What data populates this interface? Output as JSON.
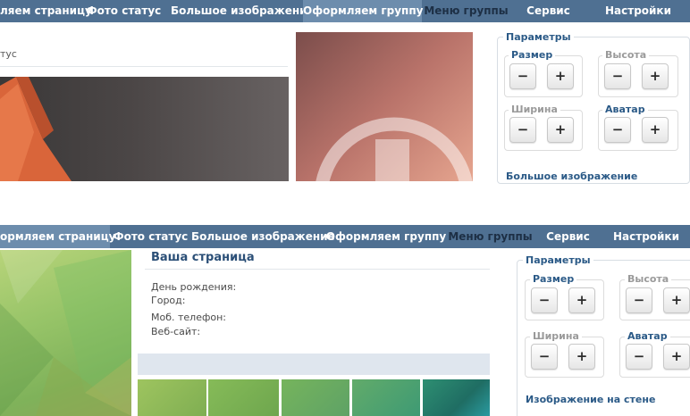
{
  "top": {
    "nav": [
      "ляем страницу",
      "Фото статус",
      "Большое изображение",
      "Оформляем группу",
      "Меню группы",
      "Сервис",
      "Настройки"
    ],
    "status_fragment": "тус",
    "params": {
      "title": "Параметры",
      "groups": [
        {
          "label": "Размер",
          "minus": "−",
          "plus": "+"
        },
        {
          "label": "Высота",
          "minus": "−",
          "plus": "+"
        },
        {
          "label": "Ширина",
          "minus": "−",
          "plus": "+"
        },
        {
          "label": "Аватар",
          "minus": "−",
          "plus": "+"
        }
      ],
      "next_section": "Большое изображение"
    }
  },
  "bottom": {
    "nav": [
      "ормляем страницу",
      "Фото статус",
      "Большое изображение",
      "Оформляем группу",
      "Меню группы",
      "Сервис",
      "Настройки"
    ],
    "page_title": "Ваша страница",
    "info": [
      "День рождения:",
      "Город:",
      "Моб. телефон:",
      "Веб-сайт:"
    ],
    "params": {
      "title": "Параметры",
      "groups": [
        {
          "label": "Размер",
          "minus": "−",
          "plus": "+"
        },
        {
          "label": "Высота",
          "minus": "−",
          "plus": "+"
        },
        {
          "label": "Ширина",
          "minus": "−",
          "plus": "+"
        },
        {
          "label": "Аватар",
          "minus": "−",
          "plus": "+"
        }
      ],
      "next_section": "Изображение на стене"
    }
  },
  "colors": {
    "nav_bg": "#4f7092",
    "nav_active": "#6d8dad",
    "accent": "#2b5a87"
  }
}
